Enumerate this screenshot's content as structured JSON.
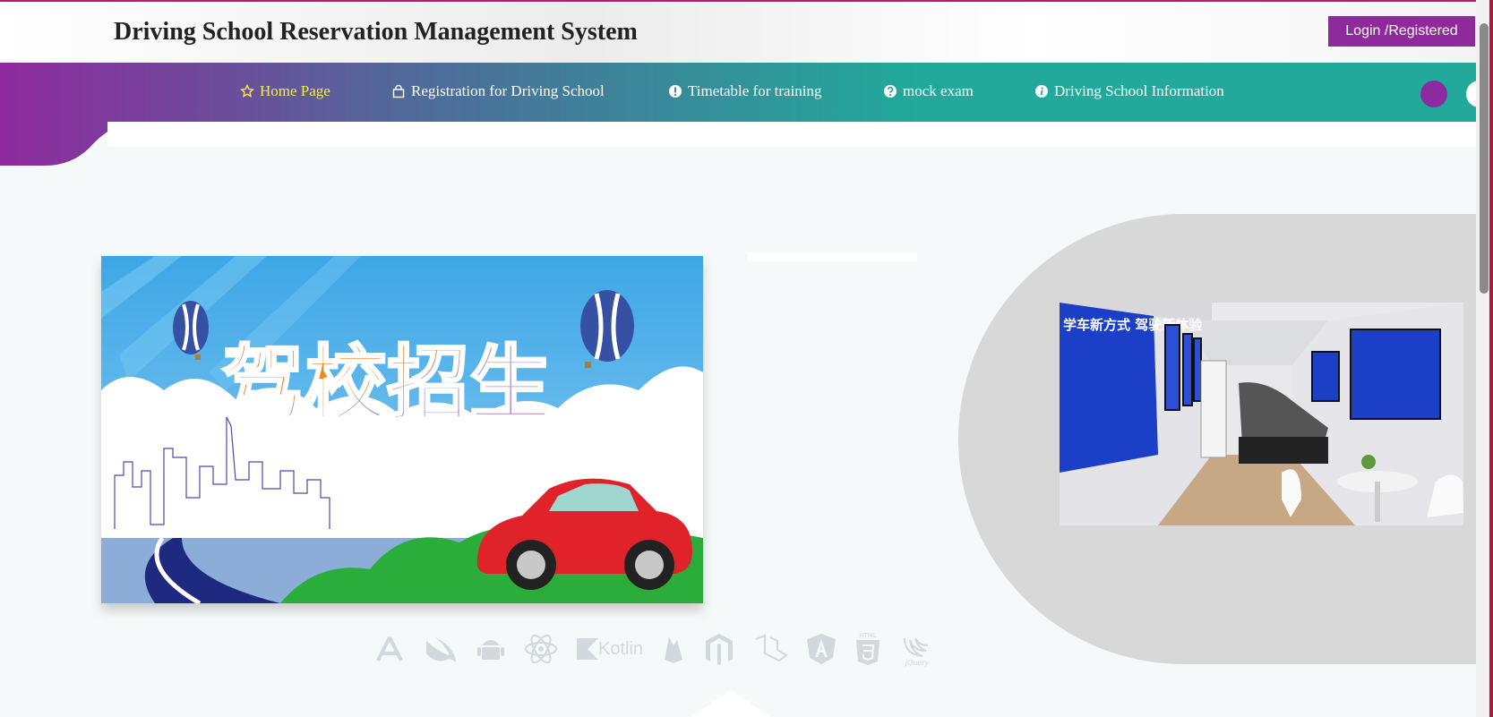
{
  "header": {
    "title": "Driving School Reservation Management System",
    "login_label": "Login /Registered"
  },
  "nav": {
    "items": [
      {
        "label": "Home Page",
        "icon": "star-icon",
        "active": true
      },
      {
        "label": "Registration for Driving School",
        "icon": "bag-icon",
        "active": false
      },
      {
        "label": "Timetable for training",
        "icon": "exclamation-circle-icon",
        "active": false
      },
      {
        "label": "mock exam",
        "icon": "question-circle-icon",
        "active": false
      },
      {
        "label": "Driving School Information",
        "icon": "info-circle-icon",
        "active": false
      }
    ],
    "gradient": [
      "#8e2a9c",
      "#22a99b"
    ],
    "active_color": "#f6ec4c"
  },
  "banner": {
    "headline": "驾校招生",
    "image": "driving-school-enrollment-banner"
  },
  "photo": {
    "image": "simulator-training-room-photo",
    "wall_text": "学车新方式 驾驶新体验"
  },
  "tech_icons": [
    "app-store-icon",
    "swift-icon",
    "android-icon",
    "react-icon",
    "kotlin-logo",
    "firebase-icon",
    "magento-icon",
    "laravel-icon",
    "angular-icon",
    "html5-icon",
    "jquery-icon"
  ],
  "tech_text": {
    "kotlin": "Kotlin",
    "html": "HTML",
    "jquery": "jQuery"
  },
  "colors": {
    "accent": "#8e2a9c",
    "teal": "#22a99b",
    "background": "#f6f9fa"
  }
}
